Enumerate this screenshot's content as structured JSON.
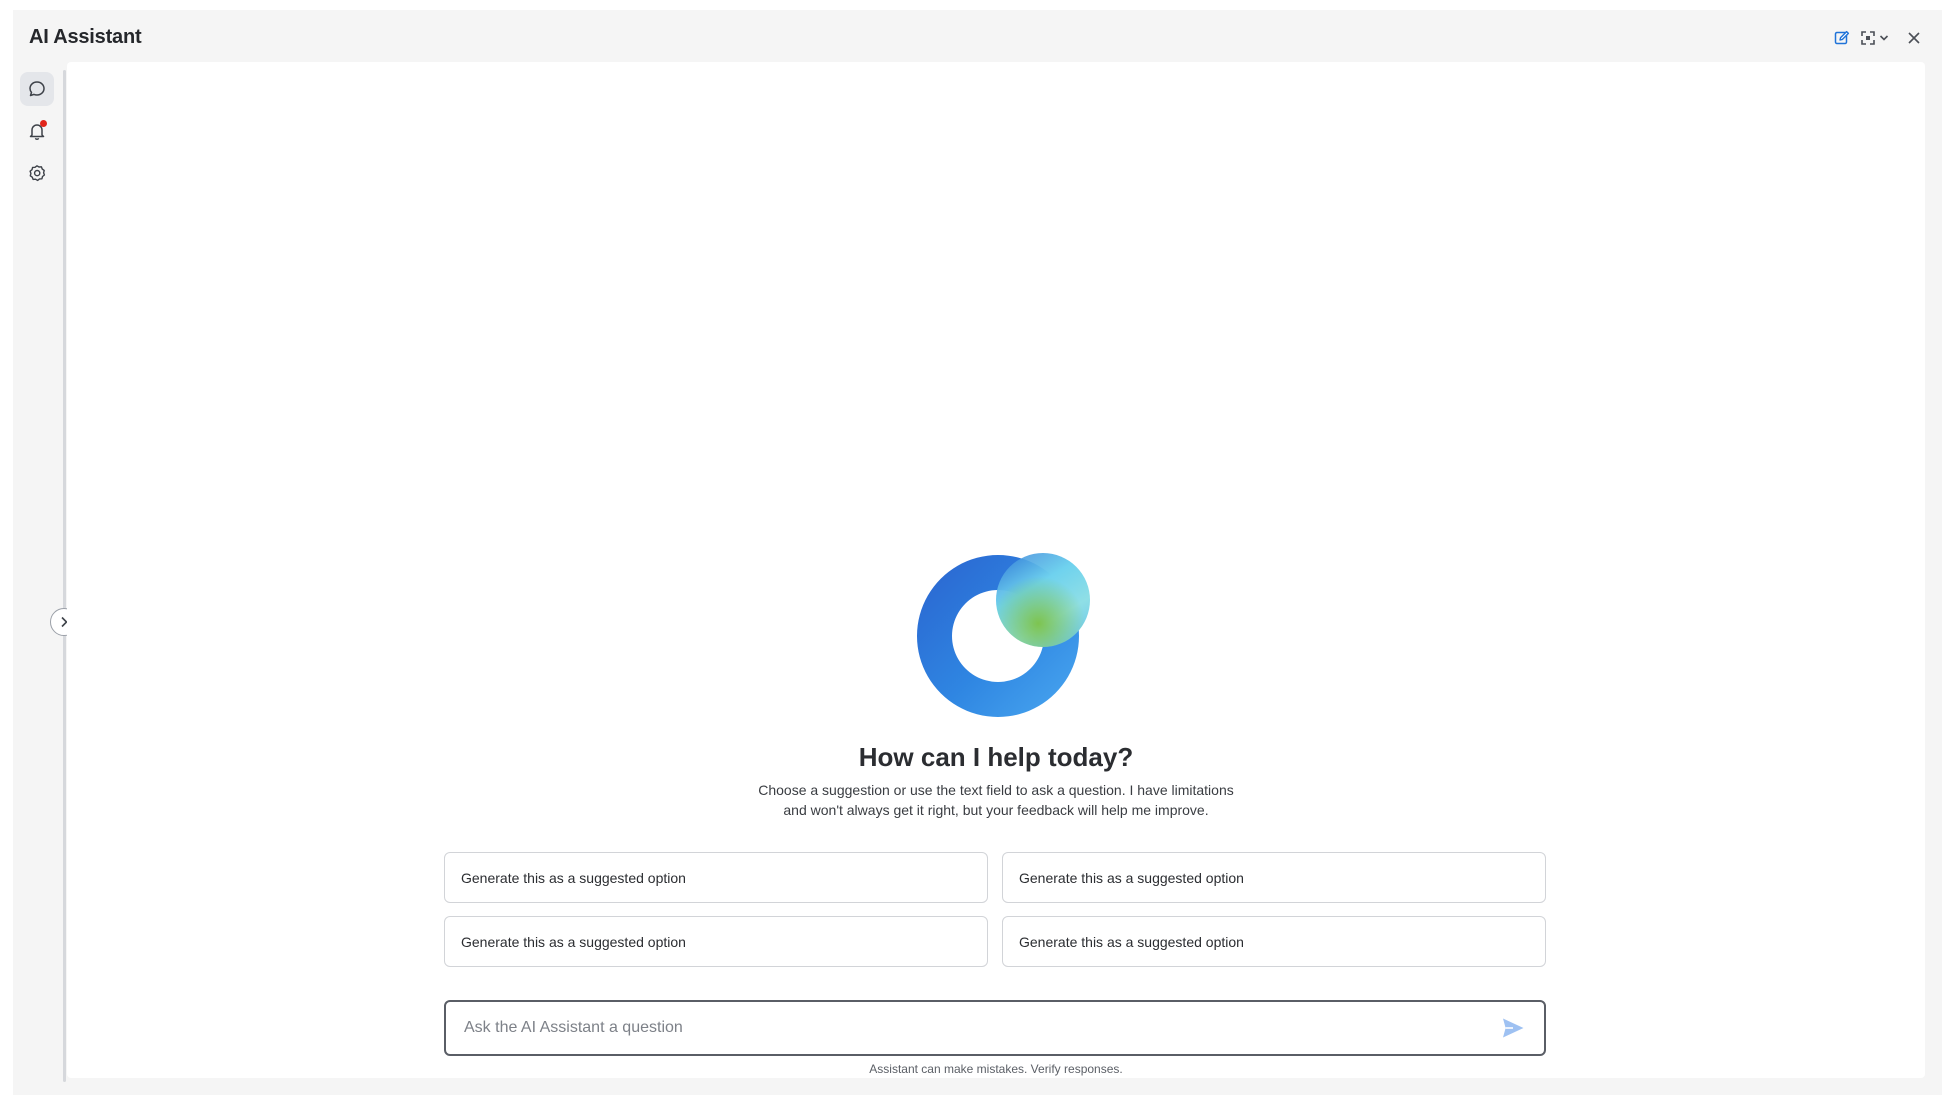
{
  "app": {
    "title": "AI Assistant"
  },
  "titlebar": {
    "new_chat_icon": "edit-icon",
    "expand_icon": "expand-icon",
    "dropdown_icon": "chevron-down-icon",
    "close_icon": "close-icon"
  },
  "sidebar": {
    "items": [
      {
        "id": "chat",
        "icon": "chat-bubble-icon",
        "active": true
      },
      {
        "id": "notifications",
        "icon": "bell-icon",
        "badge": true
      },
      {
        "id": "settings",
        "icon": "gear-icon"
      }
    ]
  },
  "welcome": {
    "heading": "How can I help today?",
    "subtext_line1": "Choose a suggestion or use the text field to ask a question. I have limitations",
    "subtext_line2": "and won't always get it right, but your feedback will help me improve."
  },
  "suggestions": [
    "Generate this as a suggested option",
    "Generate this as a suggested option",
    "Generate this as a suggested option",
    "Generate this as a suggested option"
  ],
  "input": {
    "placeholder": "Ask the AI Assistant a question",
    "value": ""
  },
  "disclaimer": "Assistant can make mistakes. Verify responses.",
  "colors": {
    "accent": "#1f73d8",
    "send": "#9ec1f2",
    "badge": "#e1251b",
    "logo_ring_start": "#2a6fd4",
    "logo_ring_end": "#4aa3ee",
    "logo_orb_start": "#8fe3f0",
    "logo_orb_end": "#5db64a"
  }
}
